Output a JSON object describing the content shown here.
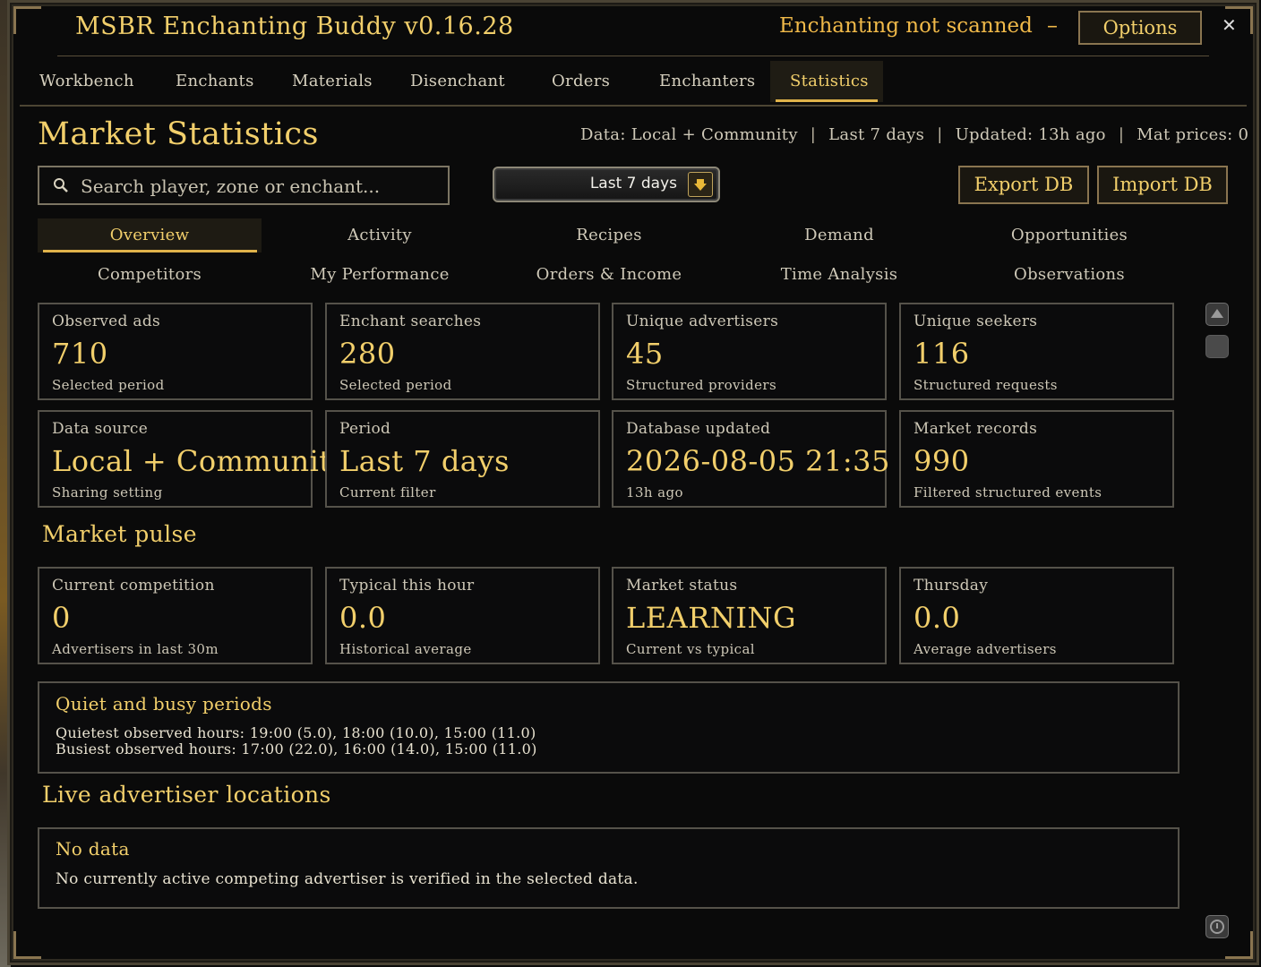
{
  "window": {
    "title": "MSBR Enchanting Buddy v0.16.28",
    "scan_status": "Enchanting not scanned",
    "minimize_glyph": "–",
    "options_label": "Options",
    "close_glyph": "✕"
  },
  "main_tabs": [
    {
      "label": "Workbench"
    },
    {
      "label": "Enchants"
    },
    {
      "label": "Materials"
    },
    {
      "label": "Disenchant"
    },
    {
      "label": "Orders"
    },
    {
      "label": "Enchanters"
    },
    {
      "label": "Statistics",
      "active": true
    }
  ],
  "header": {
    "page_title": "Market Statistics",
    "meta": {
      "data": "Data: Local + Community",
      "range": "Last 7 days",
      "updated": "Updated: 13h ago",
      "mat_prices": "Mat prices: 0",
      "separator": "|"
    }
  },
  "toolbar": {
    "search_placeholder": "Search player, zone or enchant...",
    "search_value": "",
    "period_selected": "Last 7 days",
    "export_label": "Export DB",
    "import_label": "Import DB"
  },
  "sub_tabs": [
    {
      "label": "Overview",
      "active": true
    },
    {
      "label": "Activity"
    },
    {
      "label": "Recipes"
    },
    {
      "label": "Demand"
    },
    {
      "label": "Opportunities"
    },
    {
      "label": "Competitors"
    },
    {
      "label": "My Performance"
    },
    {
      "label": "Orders & Income"
    },
    {
      "label": "Time Analysis"
    },
    {
      "label": "Observations"
    }
  ],
  "overview_cards": [
    {
      "label": "Observed ads",
      "value": "710",
      "sub": "Selected period"
    },
    {
      "label": "Enchant searches",
      "value": "280",
      "sub": "Selected period"
    },
    {
      "label": "Unique advertisers",
      "value": "45",
      "sub": "Structured providers"
    },
    {
      "label": "Unique seekers",
      "value": "116",
      "sub": "Structured requests"
    },
    {
      "label": "Data source",
      "value": "Local + Community",
      "sub": "Sharing setting"
    },
    {
      "label": "Period",
      "value": "Last 7 days",
      "sub": "Current filter"
    },
    {
      "label": "Database updated",
      "value": "2026-08-05 21:35",
      "sub": "13h ago"
    },
    {
      "label": "Market records",
      "value": "990",
      "sub": "Filtered structured events"
    }
  ],
  "market_pulse": {
    "title": "Market pulse",
    "cards": [
      {
        "label": "Current competition",
        "value": "0",
        "sub": "Advertisers in last 30m"
      },
      {
        "label": "Typical this hour",
        "value": "0.0",
        "sub": "Historical average"
      },
      {
        "label": "Market status",
        "value": "LEARNING",
        "sub": "Current vs typical"
      },
      {
        "label": "Thursday",
        "value": "0.0",
        "sub": "Average advertisers"
      }
    ]
  },
  "quiet_busy": {
    "title": "Quiet and busy periods",
    "quietest": "Quietest observed hours: 19:00 (5.0), 18:00 (10.0), 15:00 (11.0)",
    "busiest": "Busiest observed hours: 17:00 (22.0), 16:00 (14.0), 15:00 (11.0)"
  },
  "live_locations": {
    "title": "Live advertiser locations",
    "panel_title": "No data",
    "message": "No currently active competing advertiser is verified in the selected data."
  },
  "colors": {
    "accent_gold": "#f2cf6b",
    "status_orange": "#f0b949",
    "border_gray": "#55524a"
  },
  "icons": {
    "search": "search-icon",
    "dropdown": "chevron-down-icon",
    "scroll_up": "scroll-up-icon",
    "scroll_thumb": "scroll-thumb-icon",
    "scroll_bottom": "scroll-bottom-icon"
  }
}
